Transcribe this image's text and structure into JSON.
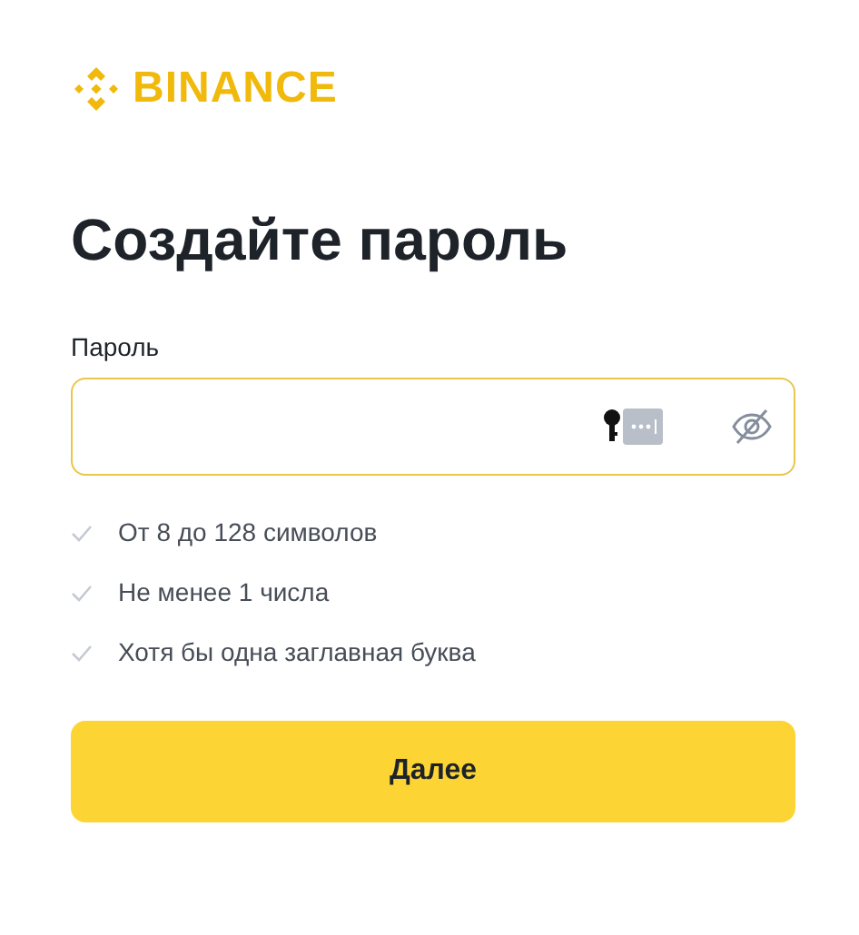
{
  "logo": {
    "text": "BINANCE"
  },
  "title": "Создайте пароль",
  "password": {
    "label": "Пароль",
    "focused": true
  },
  "rules": [
    {
      "text": "От 8 до 128 символов",
      "met": false
    },
    {
      "text": "Не менее 1 числа",
      "met": false
    },
    {
      "text": "Хотя бы одна заглавная буква",
      "met": false
    }
  ],
  "submit": "Далее"
}
